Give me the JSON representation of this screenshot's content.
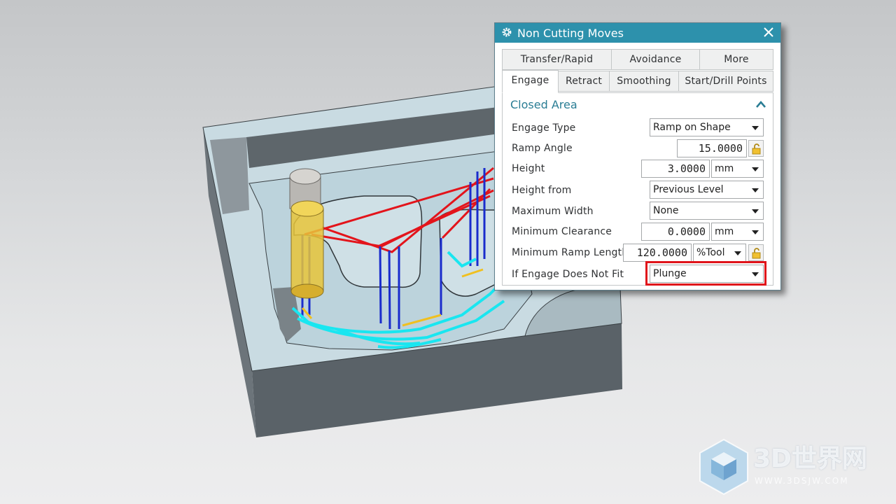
{
  "dialog": {
    "title": "Non Cutting Moves",
    "tabs_row1": [
      "Transfer/Rapid",
      "Avoidance",
      "More"
    ],
    "tabs_row2": [
      "Engage",
      "Retract",
      "Smoothing",
      "Start/Drill Points"
    ],
    "active_tab": "Engage",
    "group": {
      "title": "Closed Area",
      "fields": {
        "engage_type": {
          "label": "Engage Type",
          "value": "Ramp on Shape"
        },
        "ramp_angle": {
          "label": "Ramp Angle",
          "value": "15.0000"
        },
        "height": {
          "label": "Height",
          "value": "3.0000",
          "unit": "mm"
        },
        "height_from": {
          "label": "Height from",
          "value": "Previous Level"
        },
        "maximum_width": {
          "label": "Maximum Width",
          "value": "None"
        },
        "minimum_clearance": {
          "label": "Minimum Clearance",
          "value": "0.0000",
          "unit": "mm"
        },
        "minimum_ramp_length": {
          "label": "Minimum Ramp Length",
          "value": "120.0000",
          "unit": "%Tool"
        },
        "if_engage_does_not_fit": {
          "label": "If Engage Does Not Fit",
          "value": "Plunge"
        }
      }
    }
  },
  "colors": {
    "titlebar": "#2d91ac",
    "group_title": "#2a7d94",
    "highlight": "#e0141b",
    "toolpath_red": "#e3141b",
    "toolpath_blue": "#1a2ccc",
    "toolpath_cyan": "#19e6f0",
    "tool": "#e8c43a"
  },
  "icons": {
    "title": "gear-icon",
    "close": "close-icon",
    "collapse": "chevron-up-icon",
    "lock": "unlock-icon",
    "watermark": "cube-logo-icon"
  },
  "watermark": {
    "name": "3D世界网",
    "url": "WWW.3DSJW.COM"
  }
}
